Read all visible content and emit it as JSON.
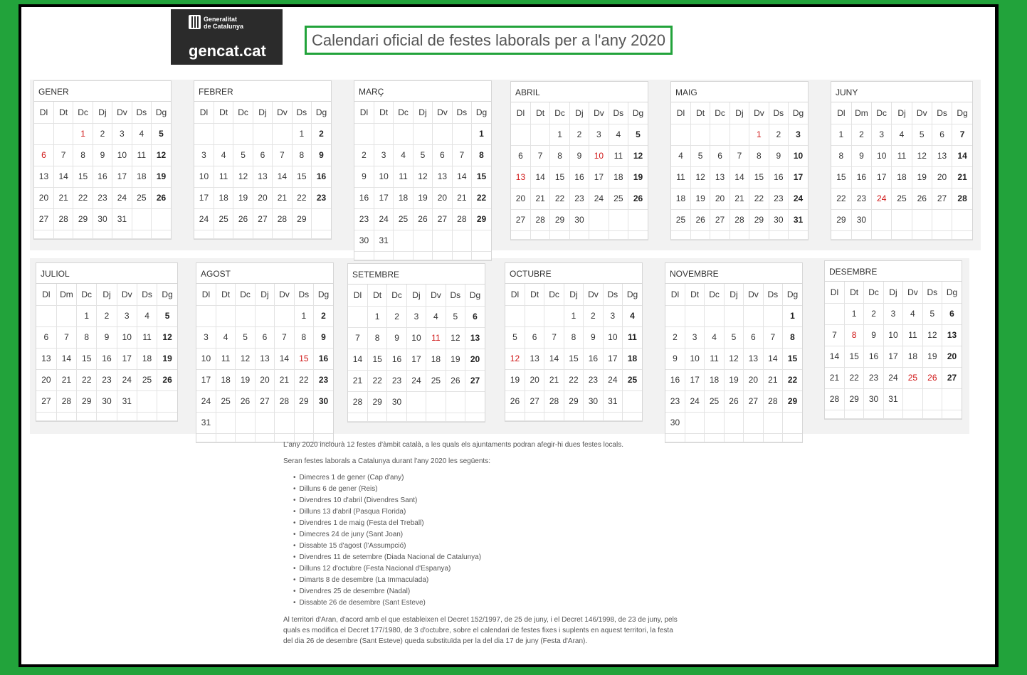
{
  "logo": {
    "line1": "Generalitat",
    "line2": "de Catalunya",
    "main": "gencat.cat"
  },
  "title": "Calendari oficial de festes laborals per a l'any 2020",
  "months": [
    {
      "name": "GENER",
      "days": [
        "Dl",
        "Dt",
        "Dc",
        "Dj",
        "Dv",
        "Ds",
        "Dg"
      ],
      "first": 2,
      "count": 31,
      "holidays": [
        1,
        6
      ]
    },
    {
      "name": "FEBRER",
      "days": [
        "Dl",
        "Dt",
        "Dc",
        "Dj",
        "Dv",
        "Ds",
        "Dg"
      ],
      "first": 5,
      "count": 29,
      "holidays": []
    },
    {
      "name": "MARÇ",
      "days": [
        "Dl",
        "Dt",
        "Dc",
        "Dj",
        "Dv",
        "Ds",
        "Dg"
      ],
      "first": 6,
      "count": 31,
      "holidays": []
    },
    {
      "name": "ABRIL",
      "days": [
        "Dl",
        "Dt",
        "Dc",
        "Dj",
        "Dv",
        "Ds",
        "Dg"
      ],
      "first": 2,
      "count": 30,
      "holidays": [
        10,
        13
      ]
    },
    {
      "name": "MAIG",
      "days": [
        "Dl",
        "Dt",
        "Dc",
        "Dj",
        "Dv",
        "Ds",
        "Dg"
      ],
      "first": 4,
      "count": 31,
      "holidays": [
        1
      ]
    },
    {
      "name": "JUNY",
      "days": [
        "Dl",
        "Dm",
        "Dc",
        "Dj",
        "Dv",
        "Ds",
        "Dg"
      ],
      "first": 0,
      "count": 30,
      "holidays": [
        24
      ]
    },
    {
      "name": "JULIOL",
      "days": [
        "Dl",
        "Dm",
        "Dc",
        "Dj",
        "Dv",
        "Ds",
        "Dg"
      ],
      "first": 2,
      "count": 31,
      "holidays": []
    },
    {
      "name": "AGOST",
      "days": [
        "Dl",
        "Dt",
        "Dc",
        "Dj",
        "Dv",
        "Ds",
        "Dg"
      ],
      "first": 5,
      "count": 31,
      "holidays": [
        15
      ]
    },
    {
      "name": "SETEMBRE",
      "days": [
        "Dl",
        "Dt",
        "Dc",
        "Dj",
        "Dv",
        "Ds",
        "Dg"
      ],
      "first": 1,
      "count": 30,
      "holidays": [
        11
      ]
    },
    {
      "name": "OCTUBRE",
      "days": [
        "Dl",
        "Dt",
        "Dc",
        "Dj",
        "Dv",
        "Ds",
        "Dg"
      ],
      "first": 3,
      "count": 31,
      "holidays": [
        12
      ]
    },
    {
      "name": "NOVEMBRE",
      "days": [
        "Dl",
        "Dt",
        "Dc",
        "Dj",
        "Dv",
        "Ds",
        "Dg"
      ],
      "first": 6,
      "count": 30,
      "holidays": []
    },
    {
      "name": "DESEMBRE",
      "days": [
        "Dl",
        "Dt",
        "Dc",
        "Dj",
        "Dv",
        "Ds",
        "Dg"
      ],
      "first": 1,
      "count": 31,
      "holidays": [
        8,
        25,
        26
      ]
    }
  ],
  "text": {
    "intro": "L'any 2020 inclourà 12 festes d'àmbit català, a les quals els ajuntaments podran afegir-hi dues festes locals.",
    "lead": "Seran festes laborals a Catalunya durant l'any 2020 les següents:",
    "holidays": [
      "Dimecres 1 de gener (Cap d'any)",
      "Dilluns 6 de gener (Reis)",
      "Divendres 10 d'abril (Divendres Sant)",
      "Dilluns 13 d'abril (Pasqua Florida)",
      "Divendres 1 de maig (Festa del Treball)",
      "Dimecres 24 de juny (Sant Joan)",
      "Dissabte 15 d'agost (l'Assumpció)",
      "Divendres 11 de setembre (Diada Nacional de Catalunya)",
      "Dilluns 12 d'octubre (Festa Nacional d'Espanya)",
      "Dimarts 8 de desembre (La Immaculada)",
      "Divendres 25 de desembre (Nadal)",
      "Dissabte 26 de desembre (Sant Esteve)"
    ],
    "aran": "Al territori d'Aran, d'acord amb el que estableixen el Decret 152/1997, de 25 de juny, i el Decret 146/1998, de 23 de juny, pels quals es modifica el Decret 177/1980, de 3 d'octubre, sobre el calendari de festes fixes i suplents en aquest territori, la festa del dia 26 de desembre (Sant Esteve) queda substituïda per la del dia 17 de juny (Festa d'Aran)."
  }
}
